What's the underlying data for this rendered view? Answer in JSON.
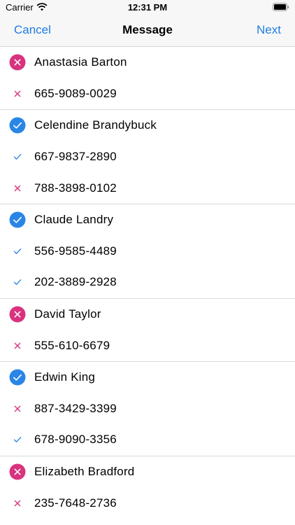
{
  "status_bar": {
    "carrier": "Carrier",
    "time": "12:31 PM"
  },
  "nav": {
    "cancel": "Cancel",
    "title": "Message",
    "next": "Next"
  },
  "groups": [
    {
      "name": "Anastasia Barton",
      "selected": false,
      "phones": [
        {
          "number": "665-9089-0029",
          "selected": false
        }
      ]
    },
    {
      "name": "Celendine Brandybuck",
      "selected": true,
      "phones": [
        {
          "number": "667-9837-2890",
          "selected": true
        },
        {
          "number": "788-3898-0102",
          "selected": false
        }
      ]
    },
    {
      "name": "Claude Landry",
      "selected": true,
      "phones": [
        {
          "number": "556-9585-4489",
          "selected": true
        },
        {
          "number": "202-3889-2928",
          "selected": true
        }
      ]
    },
    {
      "name": "David Taylor",
      "selected": false,
      "phones": [
        {
          "number": "555-610-6679",
          "selected": false
        }
      ]
    },
    {
      "name": "Edwin King",
      "selected": true,
      "phones": [
        {
          "number": "887-3429-3399",
          "selected": false
        },
        {
          "number": "678-9090-3356",
          "selected": true
        }
      ]
    },
    {
      "name": "Elizabeth Bradford",
      "selected": false,
      "phones": [
        {
          "number": "235-7648-2736",
          "selected": false
        }
      ]
    }
  ],
  "colors": {
    "accent": "#1f7ce0",
    "check": "#2a86e6",
    "cross": "#d8337e"
  },
  "icons": {
    "contact_selected": "check-circle-icon",
    "contact_unselected": "x-circle-icon",
    "phone_selected": "checkmark-icon",
    "phone_unselected": "x-mark-icon"
  }
}
